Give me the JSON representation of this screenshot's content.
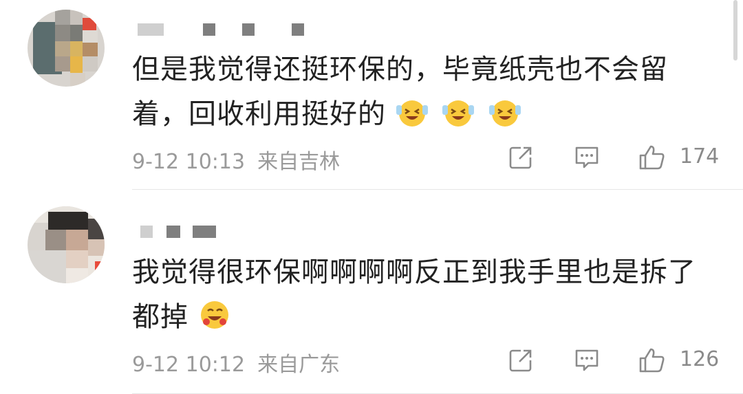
{
  "comments": [
    {
      "text_line1": "但是我觉得还挺环保的，毕竟纸壳也不会留",
      "text_line2": "着，回收利用挺好的",
      "time": "9-12 10:13",
      "location": "来自吉林",
      "likes": "174",
      "emoji_count": 3
    },
    {
      "text_line1": "我觉得很环保啊啊啊啊反正到我手里也是拆了",
      "text_line2": "都掉",
      "time": "9-12 10:12",
      "location": "来自广东",
      "likes": "126",
      "emoji_count": 1
    }
  ],
  "icons": {
    "share": "share-icon",
    "reply": "comment-icon",
    "like": "thumbs-up-icon",
    "emoji": "laughing-emoji-icon"
  },
  "colors": {
    "text": "#222222",
    "meta": "#9a9a9a",
    "icon": "#8a8a8a",
    "divider": "#e6e6e6"
  }
}
